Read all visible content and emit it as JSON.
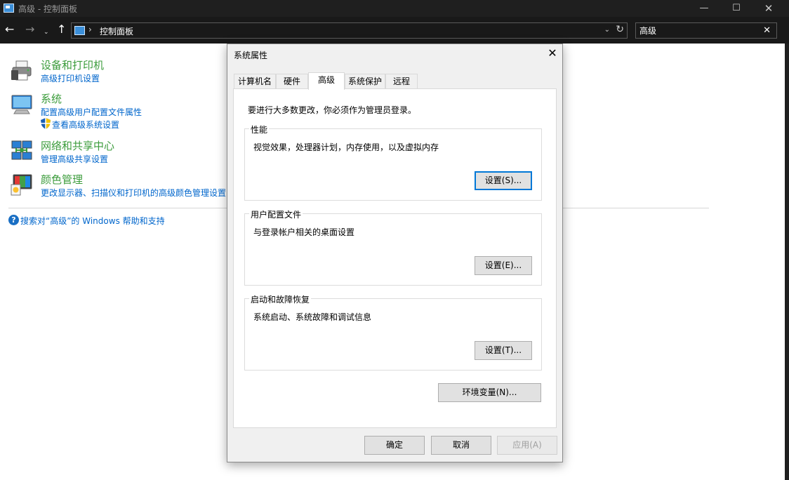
{
  "window": {
    "title": "高级 - 控制面板",
    "min_glyph": "—",
    "max_glyph": "☐",
    "close_glyph": "✕"
  },
  "nav": {
    "back_glyph": "←",
    "forward_glyph": "→",
    "recent_glyph": "⌄",
    "up_glyph": "↑",
    "separator": "›",
    "breadcrumb": "控制面板",
    "dropdown_glyph": "⌄",
    "refresh_glyph": "↻"
  },
  "search": {
    "value": "高级",
    "clear_glyph": "✕"
  },
  "results": [
    {
      "title": "设备和打印机",
      "links": [
        "高级打印机设置"
      ],
      "icon": "printer-icon"
    },
    {
      "title": "系统",
      "links": [
        "配置高级用户配置文件属性",
        "查看高级系统设置"
      ],
      "icon": "computer-icon"
    },
    {
      "title": "网络和共享中心",
      "links": [
        "管理高级共享设置"
      ],
      "icon": "network-icon"
    },
    {
      "title": "颜色管理",
      "links": [
        "更改显示器、扫描仪和打印机的高级颜色管理设置"
      ],
      "icon": "color-management-icon"
    }
  ],
  "help": {
    "glyph": "?",
    "text": "搜索对“高级”的 Windows 帮助和支持"
  },
  "dialog": {
    "title": "系统属性",
    "close_glyph": "✕",
    "tabs": [
      "计算机名",
      "硬件",
      "高级",
      "系统保护",
      "远程"
    ],
    "active_tab": "高级",
    "notice": "要进行大多数更改，你必须作为管理员登录。",
    "groups": [
      {
        "label": "性能",
        "description": "视觉效果，处理器计划，内存使用，以及虚拟内存",
        "button": "设置(S)..."
      },
      {
        "label": "用户配置文件",
        "description": "与登录帐户相关的桌面设置",
        "button": "设置(E)..."
      },
      {
        "label": "启动和故障恢复",
        "description": "系统启动、系统故障和调试信息",
        "button": "设置(T)..."
      }
    ],
    "env_button": "环境变量(N)...",
    "ok_button": "确定",
    "cancel_button": "取消",
    "apply_button": "应用(A)"
  }
}
